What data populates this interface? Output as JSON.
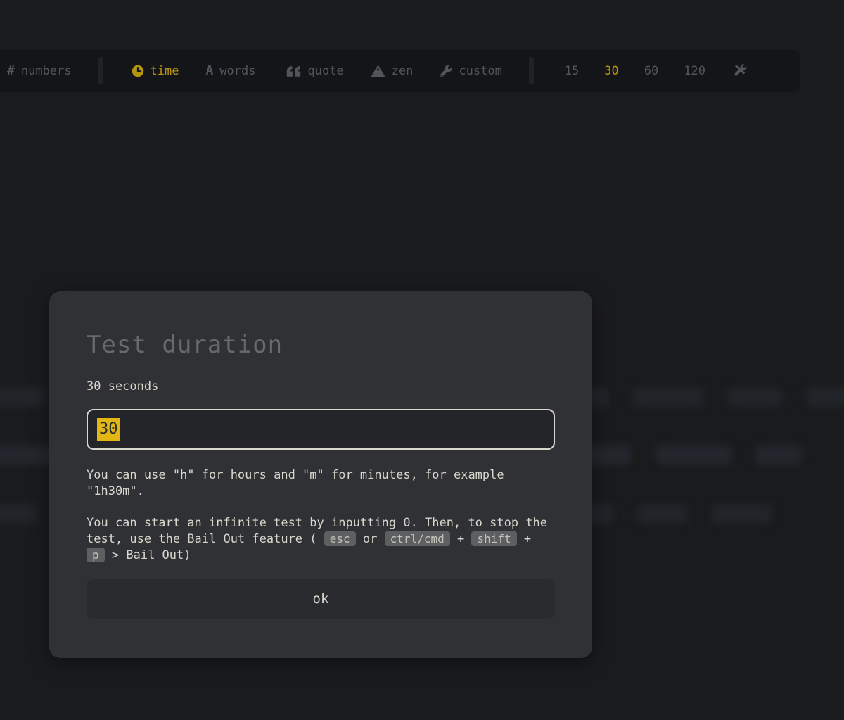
{
  "topbar": {
    "mode_items": [
      {
        "label": "numbers",
        "icon": "hashtag-icon",
        "active": false
      },
      {
        "label": "time",
        "icon": "clock-icon",
        "active": true
      },
      {
        "label": "words",
        "icon": "font-icon",
        "active": false
      },
      {
        "label": "quote",
        "icon": "quote-icon",
        "active": false
      },
      {
        "label": "zen",
        "icon": "mountain-icon",
        "active": false
      },
      {
        "label": "custom",
        "icon": "wrench-icon",
        "active": false
      }
    ],
    "durations": [
      {
        "label": "15",
        "active": false
      },
      {
        "label": "30",
        "active": true
      },
      {
        "label": "60",
        "active": false
      },
      {
        "label": "120",
        "active": false
      }
    ]
  },
  "modal": {
    "title": "Test duration",
    "current_value_text": "30 seconds",
    "input_value": "30",
    "hint_hours_minutes": "You can use \"h\" for hours and \"m\" for minutes, for example \"1h30m\".",
    "bail": {
      "part1": "You can start an infinite test by inputting 0. Then, to stop the test, use the Bail Out feature (",
      "or": "or",
      "plus": "+",
      "end": "> Bail Out)",
      "keys": [
        "esc",
        "ctrl/cmd",
        "shift",
        "p"
      ]
    },
    "ok_label": "ok"
  },
  "colors": {
    "accent": "#e2b714",
    "accent_dimmed": "#b5940e",
    "modal_bg": "#2f3134",
    "page_bg": "#1a1b1d",
    "bar_bg": "#141518",
    "text_main": "#d8d7cd",
    "text_sub": "#67696d"
  }
}
